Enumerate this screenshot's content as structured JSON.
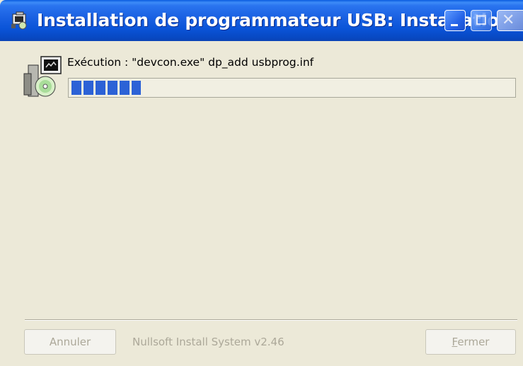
{
  "window": {
    "title": "Installation de programmateur USB: Installation d..."
  },
  "title_buttons": {
    "minimize_icon": "minimize-icon",
    "maximize_icon": "maximize-icon",
    "close_icon": "close-icon"
  },
  "content": {
    "status_text": "Exécution : \"devcon.exe\" dp_add usbprog.inf",
    "progress_fraction": 0.16
  },
  "footer": {
    "cancel_label": "Annuler",
    "branding": "Nullsoft Install System v2.46",
    "close_label_first": "F",
    "close_label_rest": "ermer"
  },
  "colors": {
    "titlebar": "#0a54d8",
    "progress_fill": "#2c62d6",
    "window_bg": "#ece9d8",
    "disabled_text": "#aca899"
  }
}
